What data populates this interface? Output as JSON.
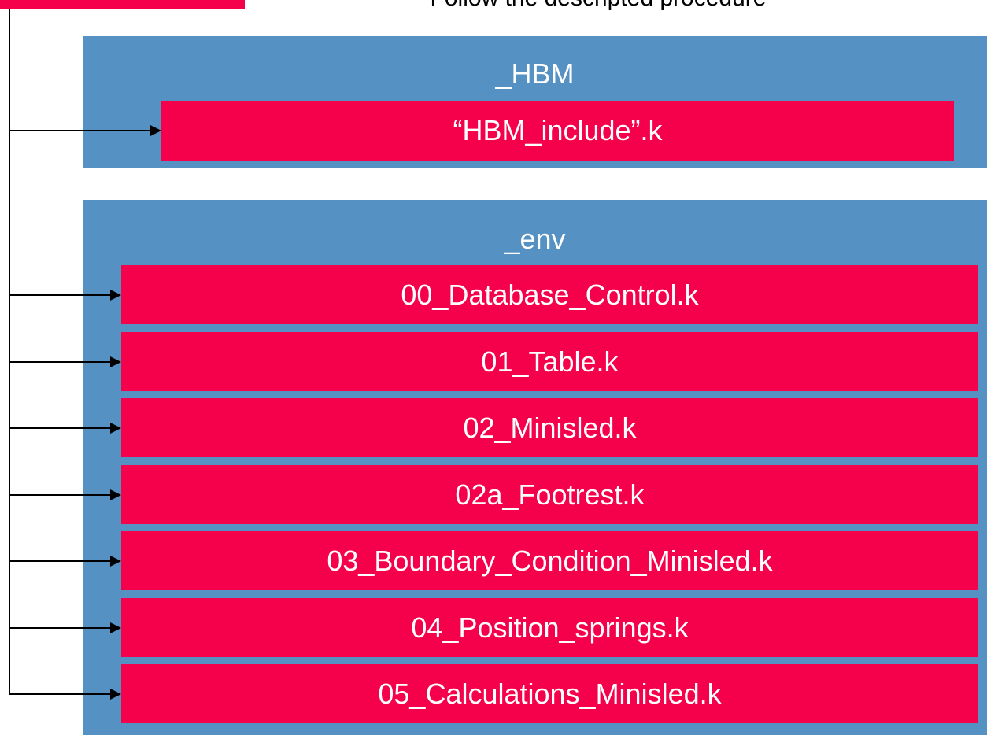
{
  "header": {
    "caption": "Follow the descripted procedure"
  },
  "groups": [
    {
      "title": "_HBM",
      "files": [
        "“HBM_include”.k"
      ]
    },
    {
      "title": "_env",
      "files": [
        "00_Database_Control.k",
        "01_Table.k",
        "02_Minisled.k",
        "02a_Footrest.k",
        "03_Boundary_Condition_Minisled.k",
        "04_Position_springs.k",
        "05_Calculations_Minisled.k"
      ]
    }
  ],
  "colors": {
    "group_bg": "#5591c2",
    "file_bg": "#f5004a",
    "text": "#ffffff",
    "connector": "#000000"
  }
}
